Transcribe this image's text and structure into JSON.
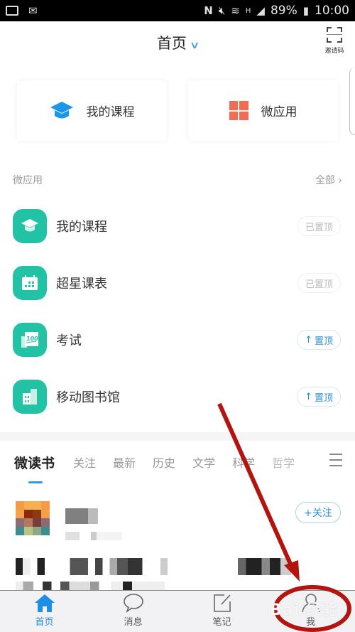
{
  "status_bar": {
    "left_icons": [
      "gallery-icon",
      "mail-icon"
    ],
    "right_icons": [
      "nfc-icon",
      "mute-icon",
      "wifi-icon",
      "network-h-icon",
      "signal-icon"
    ],
    "battery": "89%",
    "time": "10:00"
  },
  "header": {
    "title": "首页",
    "title_icon": "chevron-down-icon",
    "invite_label": "邀请码",
    "invite_icon": "scan-icon"
  },
  "quick_cards": [
    {
      "label": "我的课程",
      "icon": "graduation-cap-icon",
      "color": "#1e96e8"
    },
    {
      "label": "微应用",
      "icon": "grid-icon",
      "color": "#f26c54"
    }
  ],
  "micro_apps": {
    "title": "微应用",
    "all_label": "全部",
    "items": [
      {
        "name": "我的课程",
        "icon": "graduation-cap-icon",
        "pin_label": "已置顶",
        "pinned": true
      },
      {
        "name": "超星课表",
        "icon": "calendar-icon",
        "pin_label": "已置顶",
        "pinned": true
      },
      {
        "name": "考试",
        "icon": "exam-100-icon",
        "pin_label": "置顶",
        "pinned": false
      },
      {
        "name": "移动图书馆",
        "icon": "library-building-icon",
        "pin_label": "置顶",
        "pinned": false
      }
    ],
    "app_color": "#21c3a4"
  },
  "reading_tabs": {
    "items": [
      "微读书",
      "关注",
      "最新",
      "历史",
      "文学",
      "科学",
      "哲学"
    ],
    "active": "微读书",
    "accent": "#2a9ee6"
  },
  "feed": {
    "follow_label": "+关注"
  },
  "bottom_nav": {
    "items": [
      {
        "label": "首页",
        "icon": "home-icon",
        "active": true
      },
      {
        "label": "消息",
        "icon": "message-icon",
        "active": false
      },
      {
        "label": "笔记",
        "icon": "note-edit-icon",
        "active": false
      },
      {
        "label": "我",
        "icon": "person-icon",
        "active": false
      }
    ]
  },
  "annotation": {
    "color": "#b3140d",
    "watermark": "Bai 经验"
  }
}
